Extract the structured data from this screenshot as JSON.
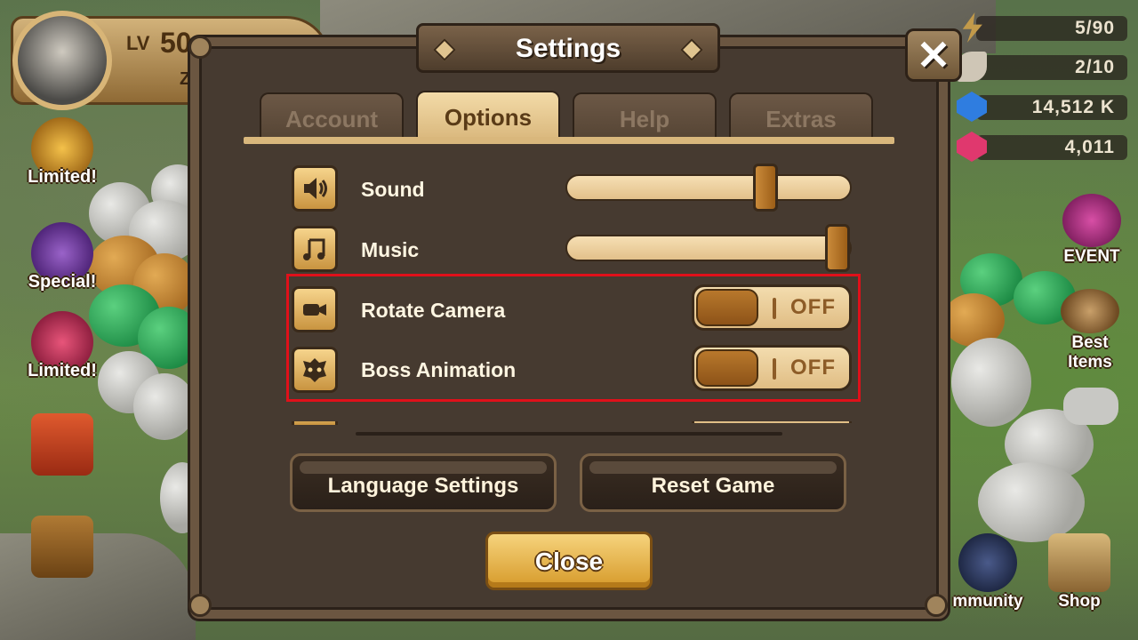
{
  "player": {
    "level_label": "LV",
    "level": "50",
    "name": "Z"
  },
  "left_menu": [
    {
      "label": "Limited!",
      "icon": "limited-scroll-icon"
    },
    {
      "label": "Special!",
      "icon": "special-scroll-icon"
    },
    {
      "label": "Limited!",
      "icon": "crystal-pack-icon"
    },
    {
      "label": "",
      "icon": "guild-banner-icon"
    },
    {
      "label": "",
      "icon": "treasure-chest-icon"
    }
  ],
  "resources": [
    {
      "value": "5/90",
      "icon": "energy-icon"
    },
    {
      "value": "2/10",
      "icon": "wing-icon"
    },
    {
      "value": "14,512 K",
      "icon": "mana-crystal-icon"
    },
    {
      "value": "4,011",
      "icon": "crystal-icon"
    }
  ],
  "right_menu": [
    {
      "label": "EVENT",
      "icon": "gift-icon"
    },
    {
      "label": "Best Items",
      "icon": "item-bag-icon"
    },
    {
      "label": "",
      "icon": "gamepad-icon"
    },
    {
      "label": "mmunity",
      "icon": "wizard-icon"
    },
    {
      "label": "Shop",
      "icon": "shop-icon"
    }
  ],
  "settings": {
    "title": "Settings",
    "tabs": [
      {
        "label": "Account",
        "active": false
      },
      {
        "label": "Options",
        "active": true
      },
      {
        "label": "Help",
        "active": false
      },
      {
        "label": "Extras",
        "active": false
      }
    ],
    "options": [
      {
        "label": "Sound",
        "type": "slider",
        "value": 0.72,
        "icon": "speaker-icon"
      },
      {
        "label": "Music",
        "type": "slider",
        "value": 1.0,
        "icon": "music-note-icon"
      },
      {
        "label": "Rotate Camera",
        "type": "toggle",
        "state": "OFF",
        "icon": "camera-icon"
      },
      {
        "label": "Boss Animation",
        "type": "toggle",
        "state": "OFF",
        "icon": "boss-mask-icon"
      }
    ],
    "buttons": {
      "language": "Language Settings",
      "reset": "Reset Game",
      "close": "Close"
    },
    "colors": {
      "highlight": "#e0101a",
      "accent": "#d9b77c",
      "panel": "#463a30"
    }
  }
}
